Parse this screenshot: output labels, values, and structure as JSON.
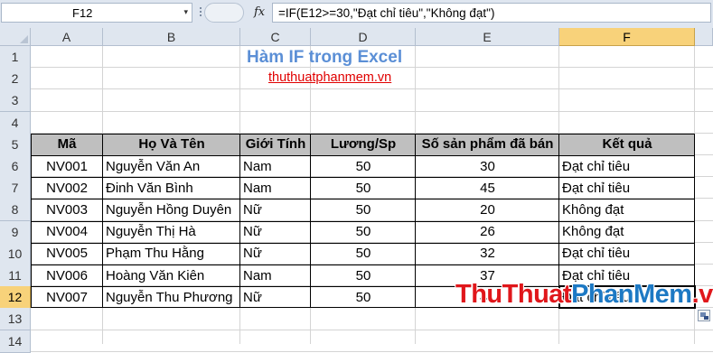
{
  "formula_bar": {
    "name_box": "F12",
    "name_dropdown_glyph": "▾",
    "fx_label": "fx",
    "formula": "=IF(E12>=30,\"Đạt chỉ tiêu\",\"Không đạt\")"
  },
  "columns": [
    "A",
    "B",
    "C",
    "D",
    "E",
    "F"
  ],
  "rows": [
    "1",
    "2",
    "3",
    "4",
    "5",
    "6",
    "7",
    "8",
    "9",
    "10",
    "11",
    "12",
    "13",
    "14"
  ],
  "selected_cell": "F12",
  "sheet": {
    "title": "Hàm IF trong Excel",
    "link": "thuthuatphanmem.vn",
    "headers": [
      "Mã",
      "Họ Và Tên",
      "Giới Tính",
      "Lương/Sp",
      "Số sản phẩm đã bán",
      "Kết quả"
    ],
    "records": [
      [
        "NV001",
        "Nguyễn Văn An",
        "Nam",
        "50",
        "30",
        "Đạt chỉ tiêu"
      ],
      [
        "NV002",
        "Đinh Văn Bình",
        "Nam",
        "50",
        "45",
        "Đạt chỉ tiêu"
      ],
      [
        "NV003",
        "Nguyễn Hồng Duyên",
        "Nữ",
        "50",
        "20",
        "Không đạt"
      ],
      [
        "NV004",
        "Nguyễn Thị Hà",
        "Nữ",
        "50",
        "26",
        "Không đạt"
      ],
      [
        "NV005",
        "Phạm Thu Hằng",
        "Nữ",
        "50",
        "32",
        "Đạt chỉ tiêu"
      ],
      [
        "NV006",
        "Hoàng Văn Kiên",
        "Nam",
        "50",
        "37",
        "Đạt chỉ tiêu"
      ],
      [
        "NV007",
        "Nguyễn Thu Phương",
        "Nữ",
        "50",
        "41",
        "Đạt chỉ tiêu"
      ]
    ]
  },
  "watermark": {
    "part1": "ThuThuat",
    "part2": "PhanMem",
    "part3": ".vn",
    "colors": {
      "red": "#e0171b",
      "blue": "#1d79c4"
    }
  },
  "colors": {
    "header_bg": "#dfe6ef",
    "selected_header_bg": "#f8d27a",
    "table_header_bg": "#bfbfbf",
    "title": "#5b8fd6",
    "link": "#e00000"
  },
  "icons": [
    "dropdown-arrow-icon",
    "fx-icon",
    "autofill-options-icon"
  ]
}
